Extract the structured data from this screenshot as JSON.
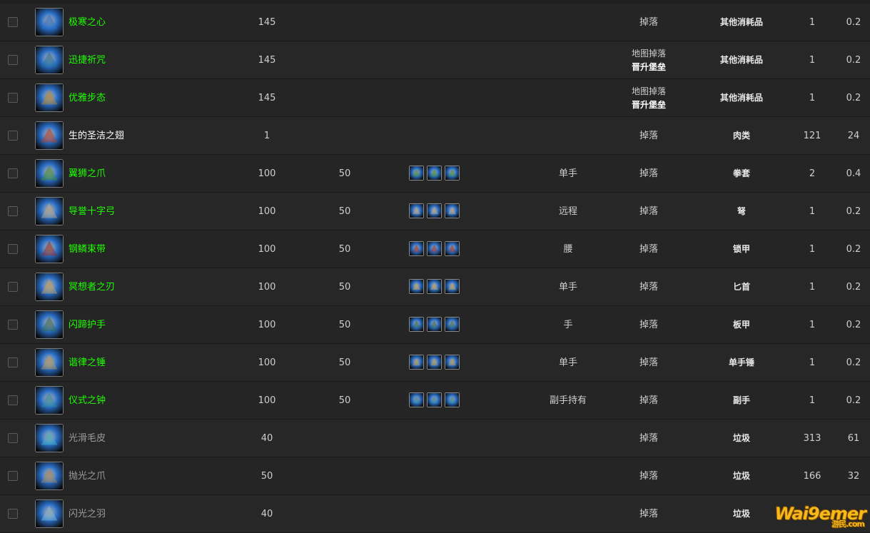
{
  "rows": [
    {
      "name": "极寒之心",
      "quality": "green",
      "ilvl": "145",
      "req": "",
      "slot": "",
      "source": "掉落",
      "source2": "",
      "type": "其他消耗品",
      "n1": "1",
      "n2": "0.2",
      "icon": "frost-heart-icon",
      "icon_color": "#2a6fc9",
      "mini": 0
    },
    {
      "name": "迅捷祈咒",
      "quality": "green",
      "ilvl": "145",
      "req": "",
      "slot": "",
      "source": "地图掉落",
      "source2": "晋升堡垒",
      "type": "其他消耗品",
      "n1": "1",
      "n2": "0.2",
      "icon": "runner-icon",
      "icon_color": "#1d6f9c",
      "mini": 0
    },
    {
      "name": "优雅步态",
      "quality": "green",
      "ilvl": "145",
      "req": "",
      "slot": "",
      "source": "地图掉落",
      "source2": "晋升堡垒",
      "type": "其他消耗品",
      "n1": "1",
      "n2": "0.2",
      "icon": "graceful-stride-icon",
      "icon_color": "#b8862a",
      "mini": 0
    },
    {
      "name": "生的圣洁之翅",
      "quality": "white",
      "ilvl": "1",
      "req": "",
      "slot": "",
      "source": "掉落",
      "source2": "",
      "type": "肉类",
      "n1": "121",
      "n2": "24",
      "icon": "raw-wing-icon",
      "icon_color": "#c0391f",
      "mini": 0
    },
    {
      "name": "翼狮之爪",
      "quality": "green",
      "ilvl": "100",
      "req": "50",
      "slot": "单手",
      "source": "掉落",
      "source2": "",
      "type": "拳套",
      "n1": "2",
      "n2": "0.4",
      "icon": "gryphon-claw-icon",
      "icon_color": "#3f8f2e",
      "mini": 3
    },
    {
      "name": "导誉十字弓",
      "quality": "green",
      "ilvl": "100",
      "req": "50",
      "slot": "远程",
      "source": "掉落",
      "source2": "",
      "type": "弩",
      "n1": "1",
      "n2": "0.2",
      "icon": "crossbow-icon",
      "icon_color": "#b9a98a",
      "mini": 3
    },
    {
      "name": "钢鳞束带",
      "quality": "green",
      "ilvl": "100",
      "req": "50",
      "slot": "腰",
      "source": "掉落",
      "source2": "",
      "type": "锁甲",
      "n1": "1",
      "n2": "0.2",
      "icon": "belt-icon",
      "icon_color": "#9b2a22",
      "mini": 3
    },
    {
      "name": "冥想者之刃",
      "quality": "green",
      "ilvl": "100",
      "req": "50",
      "slot": "单手",
      "source": "掉落",
      "source2": "",
      "type": "匕首",
      "n1": "1",
      "n2": "0.2",
      "icon": "dagger-icon",
      "icon_color": "#c8a25a",
      "mini": 3
    },
    {
      "name": "闪蹄护手",
      "quality": "green",
      "ilvl": "100",
      "req": "50",
      "slot": "手",
      "source": "掉落",
      "source2": "",
      "type": "板甲",
      "n1": "1",
      "n2": "0.2",
      "icon": "gauntlet-icon",
      "icon_color": "#2f6a4e",
      "mini": 3
    },
    {
      "name": "谐律之锤",
      "quality": "green",
      "ilvl": "100",
      "req": "50",
      "slot": "单手",
      "source": "掉落",
      "source2": "",
      "type": "单手锤",
      "n1": "1",
      "n2": "0.2",
      "icon": "mace-icon",
      "icon_color": "#b89a55",
      "mini": 3
    },
    {
      "name": "仪式之钟",
      "quality": "green",
      "ilvl": "100",
      "req": "50",
      "slot": "副手持有",
      "source": "掉落",
      "source2": "",
      "type": "副手",
      "n1": "1",
      "n2": "0.2",
      "icon": "bell-icon",
      "icon_color": "#2b8ca0",
      "mini": 3
    },
    {
      "name": "光滑毛皮",
      "quality": "gray",
      "ilvl": "40",
      "req": "",
      "slot": "",
      "source": "掉落",
      "source2": "",
      "type": "垃圾",
      "n1": "313",
      "n2": "61",
      "icon": "fur-icon",
      "icon_color": "#3fb6c9",
      "mini": 0
    },
    {
      "name": "抛光之爪",
      "quality": "gray",
      "ilvl": "50",
      "req": "",
      "slot": "",
      "source": "掉落",
      "source2": "",
      "type": "垃圾",
      "n1": "166",
      "n2": "32",
      "icon": "claw-icon",
      "icon_color": "#a88a5a",
      "mini": 0
    },
    {
      "name": "闪光之羽",
      "quality": "gray",
      "ilvl": "40",
      "req": "",
      "slot": "",
      "source": "掉落",
      "source2": "",
      "type": "垃圾",
      "n1": "",
      "n2": "",
      "icon": "feather-icon",
      "icon_color": "#7fb9d6",
      "mini": 0
    }
  ],
  "watermark": {
    "main": "Wai9emer",
    "sub": "游民.com"
  }
}
